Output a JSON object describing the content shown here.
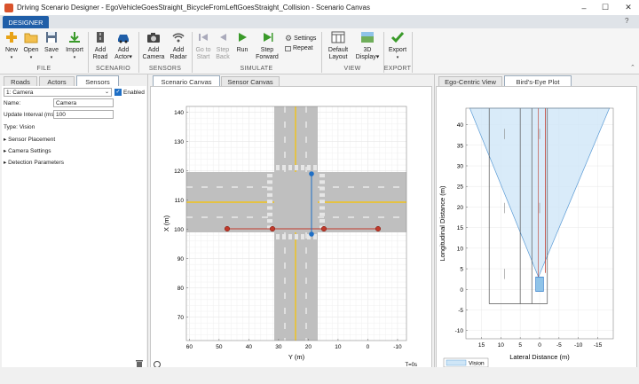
{
  "window": {
    "title": "Driving Scenario Designer - EgoVehicleGoesStraight_BicycleFromLeftGoesStraight_Collision - Scenario Canvas",
    "min_icon": "minimize-icon",
    "max_icon": "maximize-icon",
    "close_icon": "close-icon"
  },
  "ribbon": {
    "tab": "DESIGNER",
    "file": {
      "label": "FILE",
      "new": "New",
      "open": "Open",
      "save": "Save",
      "import": "Import"
    },
    "scenario": {
      "label": "SCENARIO",
      "add_road_1": "Add",
      "add_road_2": "Road",
      "add_actor_1": "Add",
      "add_actor_2": "Actor"
    },
    "sensors": {
      "label": "SENSORS",
      "add_camera_1": "Add",
      "add_camera_2": "Camera",
      "add_radar_1": "Add",
      "add_radar_2": "Radar"
    },
    "simulate": {
      "label": "SIMULATE",
      "goto_1": "Go to",
      "goto_2": "Start",
      "stepback_1": "Step",
      "stepback_2": "Back",
      "run": "Run",
      "stepfwd_1": "Step",
      "stepfwd_2": "Forward",
      "settings": "Settings",
      "repeat": "Repeat"
    },
    "view": {
      "label": "VIEW",
      "default_1": "Default",
      "default_2": "Layout",
      "display_1": "3D",
      "display_2": "Display"
    },
    "export": {
      "label": "EXPORT",
      "export": "Export"
    }
  },
  "left": {
    "tabs": [
      "Roads",
      "Actors",
      "Sensors"
    ],
    "sensor_select": "1: Camera",
    "enabled_label": "Enabled",
    "enabled": true,
    "name_label": "Name:",
    "name_value": "Camera",
    "interval_label": "Update Interval (ms):",
    "interval_value": "100",
    "type_label": "Type: Vision",
    "sections": [
      "Sensor Placement",
      "Camera Settings",
      "Detection Parameters"
    ]
  },
  "center": {
    "tabs": [
      "Scenario Canvas",
      "Sensor Canvas"
    ],
    "time": "T=0s",
    "plot": {
      "xlabel": "Y (m)",
      "ylabel": "X (m)",
      "xticks": [
        "60",
        "50",
        "40",
        "30",
        "20",
        "10",
        "0",
        "-10"
      ],
      "yticks": [
        "140",
        "130",
        "120",
        "110",
        "100",
        "90",
        "80",
        "70"
      ]
    }
  },
  "right": {
    "tabs": [
      "Ego-Centric View",
      "Bird's-Eye Plot"
    ],
    "plot": {
      "xlabel": "Lateral Distance (m)",
      "ylabel": "Longitudinal Distance (m)",
      "xticks": [
        "15",
        "10",
        "5",
        "0",
        "-5",
        "-10",
        "-15"
      ],
      "yticks": [
        "40",
        "35",
        "30",
        "25",
        "20",
        "15",
        "10",
        "5",
        "0",
        "-5",
        "-10"
      ],
      "legend": "Vision"
    }
  },
  "colors": {
    "accent": "#1f5ea8",
    "road": "#bfbfbf",
    "lane_yellow": "#f2c318",
    "actor_red": "#c0392b",
    "ego_blue": "#1f6fc5",
    "coverage": "#cfe6f7"
  }
}
